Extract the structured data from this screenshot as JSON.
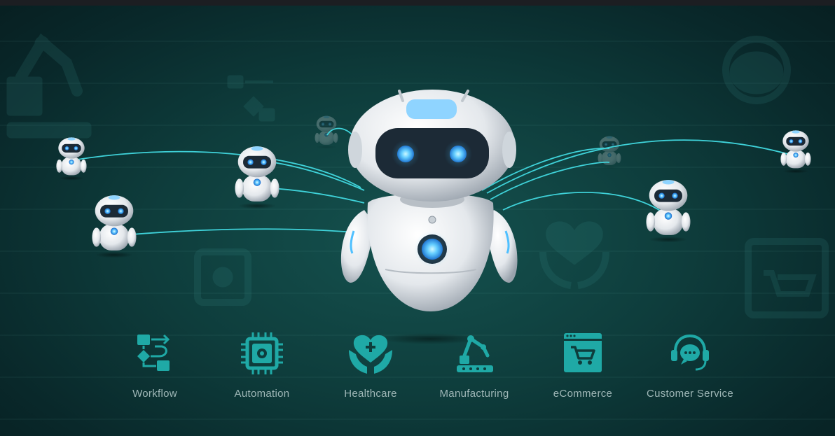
{
  "categories": [
    {
      "label": "Workflow",
      "icon": "workflow-icon"
    },
    {
      "label": "Automation",
      "icon": "chip-icon"
    },
    {
      "label": "Healthcare",
      "icon": "healthcare-hands-icon"
    },
    {
      "label": "Manufacturing",
      "icon": "robot-arm-icon"
    },
    {
      "label": "eCommerce",
      "icon": "shopping-cart-browser-icon"
    },
    {
      "label": "Customer Service",
      "icon": "headset-chat-icon"
    }
  ],
  "colors": {
    "accent": "#1fa9a6",
    "connector": "#3fd2d9",
    "label": "#9fb7b7",
    "robot_eye": "#3fa9ff"
  }
}
